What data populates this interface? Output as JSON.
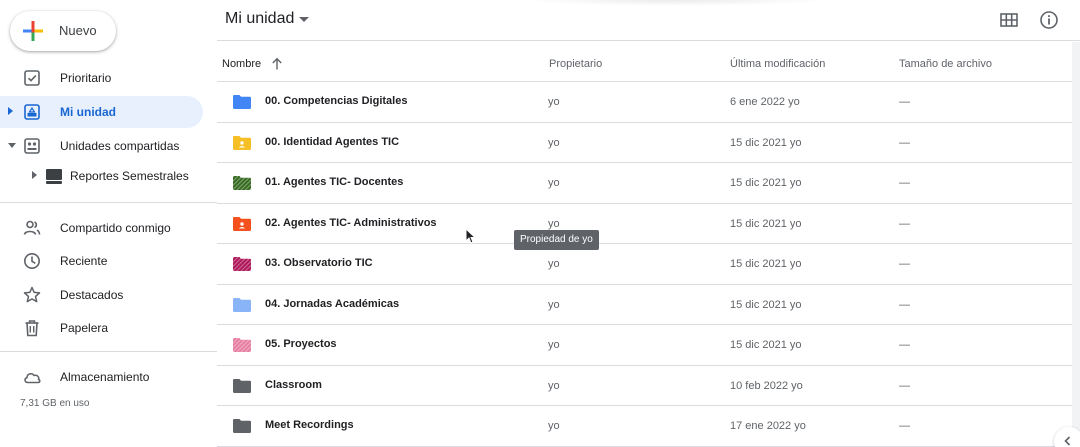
{
  "sidebar": {
    "new_label": "Nuevo",
    "items": [
      {
        "label": "Prioritario",
        "icon": "priority-icon"
      },
      {
        "label": "Mi unidad",
        "icon": "my-drive-icon"
      },
      {
        "label": "Unidades compartidas",
        "icon": "shared-drives-icon"
      },
      {
        "label": "Reportes Semestrales",
        "icon": "shared-drive-folder-icon"
      },
      {
        "label": "Compartido conmigo",
        "icon": "shared-with-me-icon"
      },
      {
        "label": "Reciente",
        "icon": "clock-icon"
      },
      {
        "label": "Destacados",
        "icon": "star-icon"
      },
      {
        "label": "Papelera",
        "icon": "trash-icon"
      },
      {
        "label": "Almacenamiento",
        "icon": "cloud-icon"
      }
    ],
    "storage_used": "7,31 GB en uso"
  },
  "header": {
    "title": "Mi unidad"
  },
  "columns": {
    "name": "Nombre",
    "owner": "Propietario",
    "modified": "Última modificación",
    "size": "Tamaño de archivo"
  },
  "files": [
    {
      "name": "00. Competencias Digitales",
      "owner": "yo",
      "modified": "6 ene 2022  yo",
      "size": "—",
      "color": "#4285f4",
      "type": "folder"
    },
    {
      "name": "00. Identidad Agentes TIC",
      "owner": "yo",
      "modified": "15 dic 2021  yo",
      "size": "—",
      "color": "#f6bf26",
      "type": "shared-folder"
    },
    {
      "name": "01. Agentes TIC- Docentes",
      "owner": "yo",
      "modified": "15 dic 2021  yo",
      "size": "—",
      "color": "#33691e",
      "type": "striped-folder"
    },
    {
      "name": "02. Agentes TIC- Administrativos",
      "owner": "yo",
      "modified": "15 dic 2021  yo",
      "size": "—",
      "color": "#f4511e",
      "type": "shared-folder"
    },
    {
      "name": "03. Observatorio TIC",
      "owner": "yo",
      "modified": "15 dic 2021  yo",
      "size": "—",
      "color": "#ad1457",
      "type": "striped-folder"
    },
    {
      "name": "04. Jornadas Académicas",
      "owner": "yo",
      "modified": "15 dic 2021  yo",
      "size": "—",
      "color": "#8ab4f8",
      "type": "folder"
    },
    {
      "name": "05. Proyectos",
      "owner": "yo",
      "modified": "15 dic 2021  yo",
      "size": "—",
      "color": "#e67c9f",
      "type": "striped-folder"
    },
    {
      "name": "Classroom",
      "owner": "yo",
      "modified": "10 feb 2022  yo",
      "size": "—",
      "color": "#5f6368",
      "type": "folder"
    },
    {
      "name": "Meet Recordings",
      "owner": "yo",
      "modified": "17 ene 2022  yo",
      "size": "—",
      "color": "#5f6368",
      "type": "folder"
    }
  ],
  "tooltip": "Propiedad de yo"
}
